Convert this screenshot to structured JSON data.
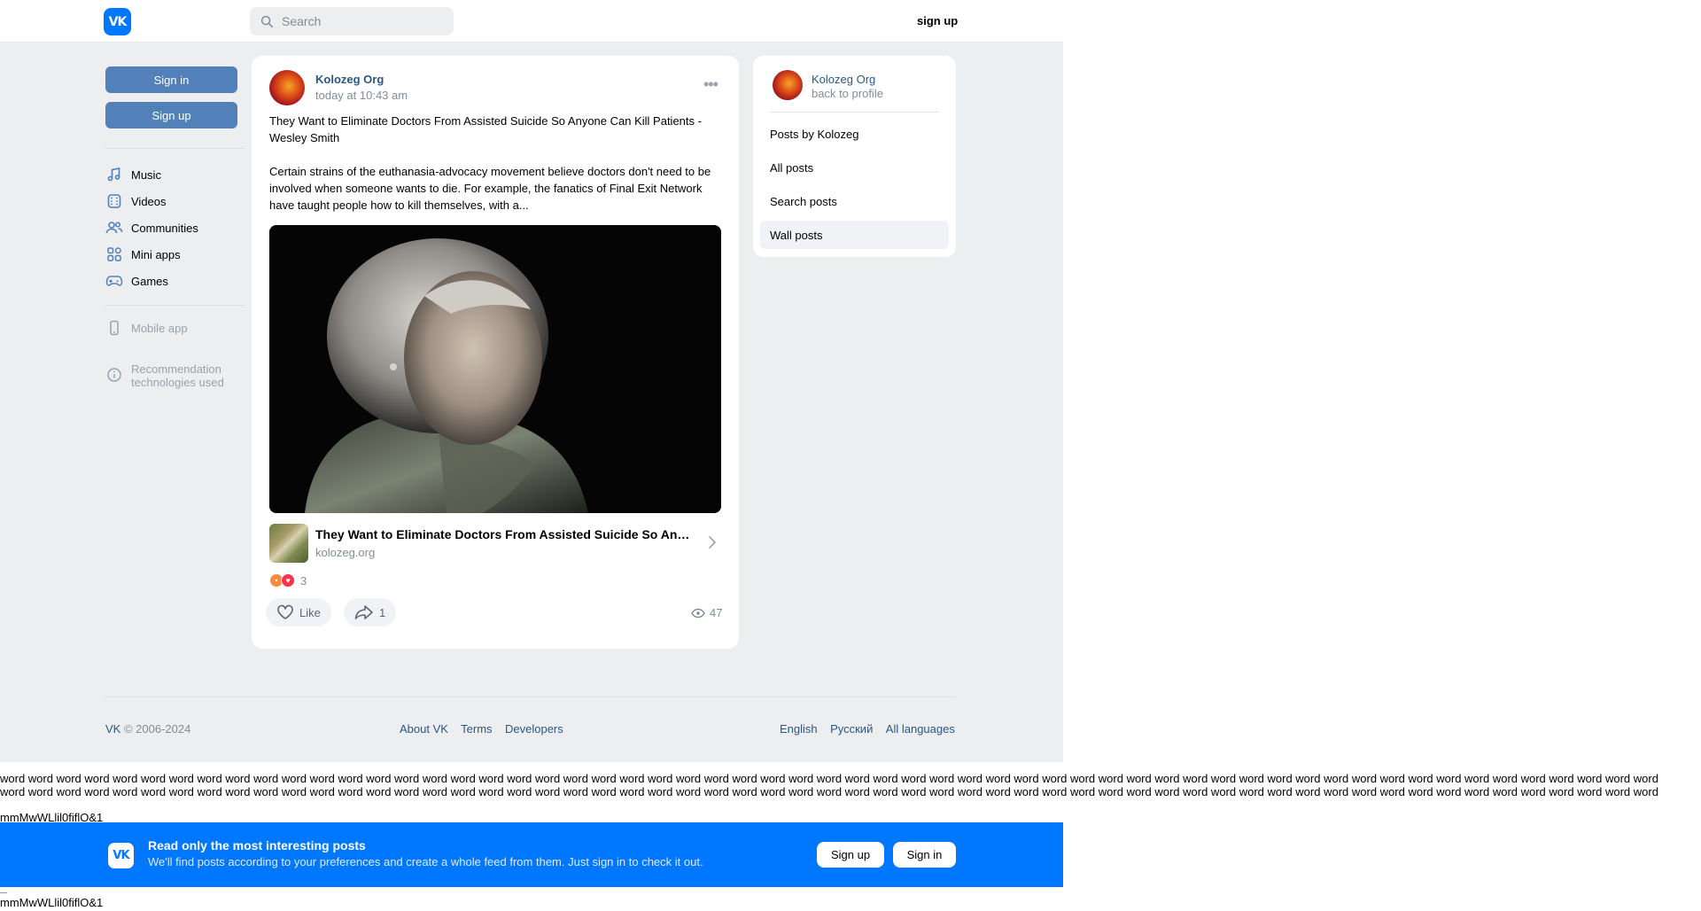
{
  "header": {
    "logo_text": "VK",
    "search_placeholder": "Search",
    "signup_label": "sign up"
  },
  "sidebar": {
    "sign_in": "Sign in",
    "sign_up": "Sign up",
    "items": [
      {
        "label": "Music",
        "icon": "music-note-icon"
      },
      {
        "label": "Videos",
        "icon": "video-icon"
      },
      {
        "label": "Communities",
        "icon": "communities-icon"
      },
      {
        "label": "Mini apps",
        "icon": "mini-apps-icon"
      },
      {
        "label": "Games",
        "icon": "gamepad-icon"
      }
    ],
    "mobile_app": "Mobile app",
    "recommendation_line1": "Recommendation",
    "recommendation_line2": "technologies used"
  },
  "post": {
    "author": "Kolozeg Org",
    "time": "today at 10:43 am",
    "title_text": "They Want to Eliminate Doctors From Assisted Suicide So Anyone Can Kill Patients - Wesley Smith",
    "body_text": "Certain strains of the euthanasia-advocacy movement believe doctors don't need to be involved when someone wants to die. For example, the fanatics of Final Exit Network have taught people how to kill themselves, with a...",
    "link_title": "They Want to Eliminate Doctors From Assisted Suicide So Anyone Can Kill Patients - Wesley Smith",
    "link_domain": "kolozeg.org",
    "reactions_count": "3",
    "like_label": "Like",
    "share_count": "1",
    "views_count": "47"
  },
  "right_menu": {
    "name": "Kolozeg Org",
    "back": "back to profile",
    "items": [
      "Posts by Kolozeg",
      "All posts",
      "Search posts",
      "Wall posts"
    ]
  },
  "footer": {
    "copyright_brand": "VK",
    "copyright_years": " © 2006-2024",
    "links": [
      "About VK",
      "Terms",
      "Developers"
    ],
    "languages": [
      "English",
      "Русский",
      "All languages"
    ]
  },
  "raw_text": {
    "words_line": "word word word word word word word word word word word word word word word word word word word word word word word word word word word word word word word word word word word word word word word word word word word word word word word word word word word word word word word word word word word",
    "glyph_line": "mmMwWLlil0fiflO&1"
  },
  "banner": {
    "title": "Read only the most interesting posts",
    "subtitle": "We'll find posts according to your preferences and create a whole feed from them. Just sign in to check it out.",
    "sign_up": "Sign up",
    "sign_in": "Sign in"
  }
}
